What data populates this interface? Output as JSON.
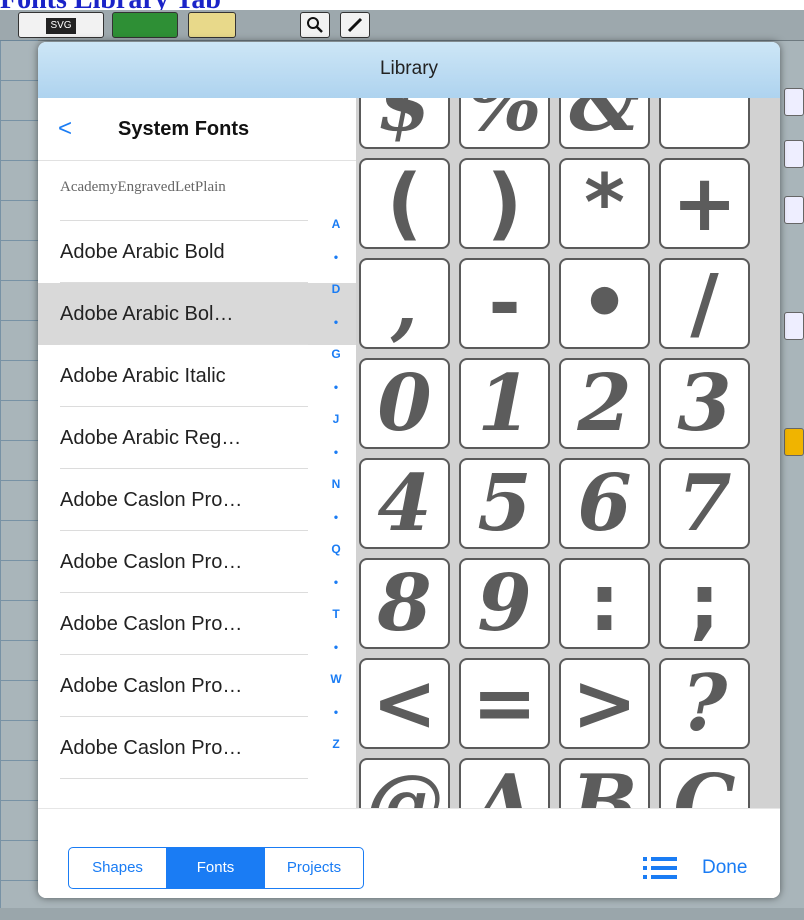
{
  "page": {
    "heading": "Fonts Library Tab"
  },
  "toolbar": {
    "svg_label": "SVG"
  },
  "modal": {
    "title": "Library"
  },
  "left_panel": {
    "back_symbol": "<",
    "title": "System Fonts",
    "items": [
      {
        "label": "AcademyEngravedLetPlain",
        "selected": false
      },
      {
        "label": "Adobe Arabic Bold",
        "selected": false
      },
      {
        "label": "Adobe Arabic Bol…",
        "selected": true
      },
      {
        "label": "Adobe Arabic Italic",
        "selected": false
      },
      {
        "label": "Adobe Arabic Reg…",
        "selected": false
      },
      {
        "label": "Adobe Caslon Pro…",
        "selected": false
      },
      {
        "label": "Adobe Caslon Pro…",
        "selected": false
      },
      {
        "label": "Adobe Caslon Pro…",
        "selected": false
      },
      {
        "label": "Adobe Caslon Pro…",
        "selected": false
      },
      {
        "label": "Adobe Caslon Pro…",
        "selected": false
      }
    ],
    "index": [
      "A",
      "•",
      "D",
      "•",
      "G",
      "•",
      "J",
      "•",
      "N",
      "•",
      "Q",
      "•",
      "T",
      "•",
      "W",
      "•",
      "Z"
    ]
  },
  "glyphs": [
    "$",
    "%",
    "&",
    "'",
    "(",
    ")",
    "*",
    "+",
    ",",
    "-",
    "•",
    "/",
    "0",
    "1",
    "2",
    "3",
    "4",
    "5",
    "6",
    "7",
    "8",
    "9",
    ":",
    ";",
    "<",
    "=",
    ">",
    "?",
    "@",
    "A",
    "B",
    "C"
  ],
  "bottom_bar": {
    "tabs": [
      {
        "label": "Shapes",
        "active": false
      },
      {
        "label": "Fonts",
        "active": true
      },
      {
        "label": "Projects",
        "active": false
      }
    ],
    "done_label": "Done"
  },
  "colors": {
    "accent": "#1a7cf4",
    "header_blue": "#aed3ef",
    "selected_row": "#d9d9d9",
    "glyph": "#5c5c5c"
  }
}
